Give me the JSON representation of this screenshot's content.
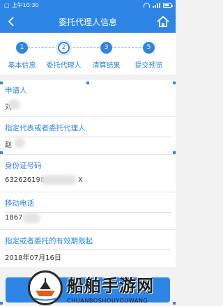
{
  "status_bar": {
    "time": "上午10:30"
  },
  "header": {
    "title": "委托代理人信息"
  },
  "steps": [
    {
      "num": "1",
      "label": "基本信息"
    },
    {
      "num": "2",
      "label": "委托代理人"
    },
    {
      "num": "3",
      "label": "清算结果"
    },
    {
      "num": "5",
      "label": "提交预览"
    }
  ],
  "fields": [
    {
      "label": "申请人",
      "value": "刘"
    },
    {
      "label": "指定代表或者委托代理人",
      "value": "赵"
    },
    {
      "label": "身份证号码",
      "value": "632626198",
      "value_tail": "X"
    },
    {
      "label": "移动电话",
      "value": "1867"
    },
    {
      "label": "指定或者委托的有效期限起",
      "value": "2018年07月16日"
    }
  ],
  "watermark": {
    "title": "船舶手游网",
    "subtitle": "CHUANBOSHOUYOUWANG"
  },
  "colors": {
    "primary": "#2d86e6",
    "label": "#2d86e6",
    "text": "#333333"
  }
}
